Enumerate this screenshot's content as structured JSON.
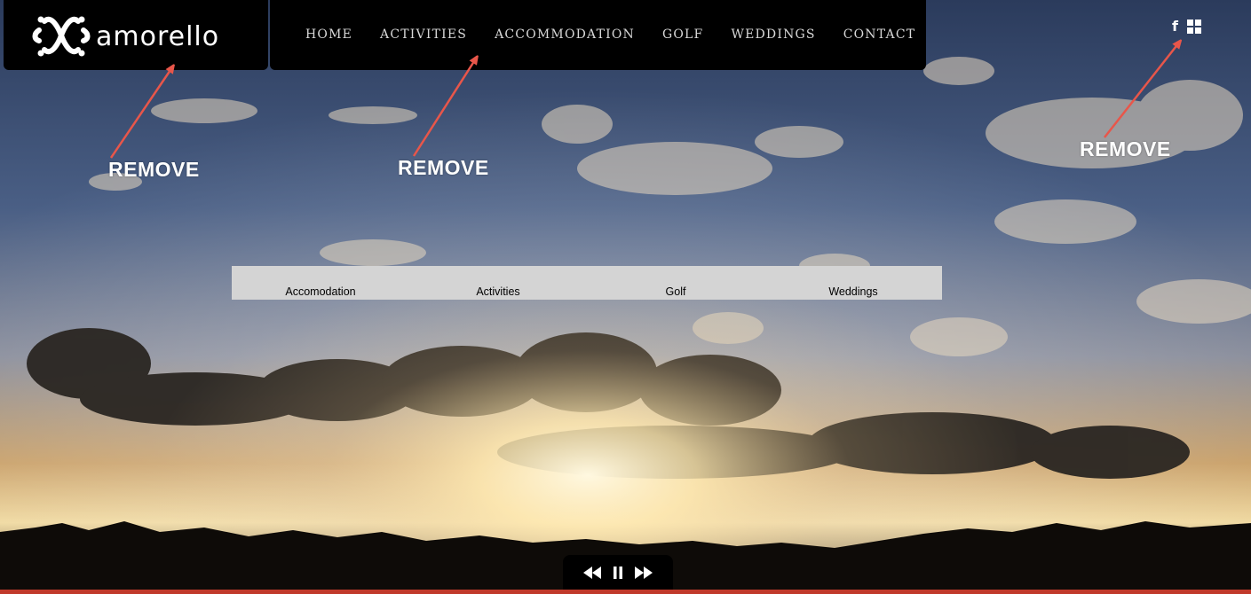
{
  "brand": {
    "logo_text": "amorello"
  },
  "nav": {
    "items": [
      "HOME",
      "ACTIVITIES",
      "ACCOMMODATION",
      "GOLF",
      "WEDDINGS",
      "CONTACT"
    ]
  },
  "social": {
    "facebook_glyph": "f",
    "icons": [
      "facebook-icon",
      "grid-icon"
    ]
  },
  "annotations": {
    "logo_label": "REMOVE",
    "nav_label": "REMOVE",
    "social_label": "REMOVE",
    "arrow_color": "#e8564a"
  },
  "submenu": {
    "items": [
      "Accomodation",
      "Activities",
      "Golf",
      "Weddings"
    ]
  },
  "slideshow": {
    "controls": [
      "rewind-icon",
      "pause-icon",
      "fast-forward-icon"
    ]
  },
  "colors": {
    "header_bg": "#000000",
    "submenu_bg": "#d4d4d4",
    "accent_line": "#c0392b"
  }
}
